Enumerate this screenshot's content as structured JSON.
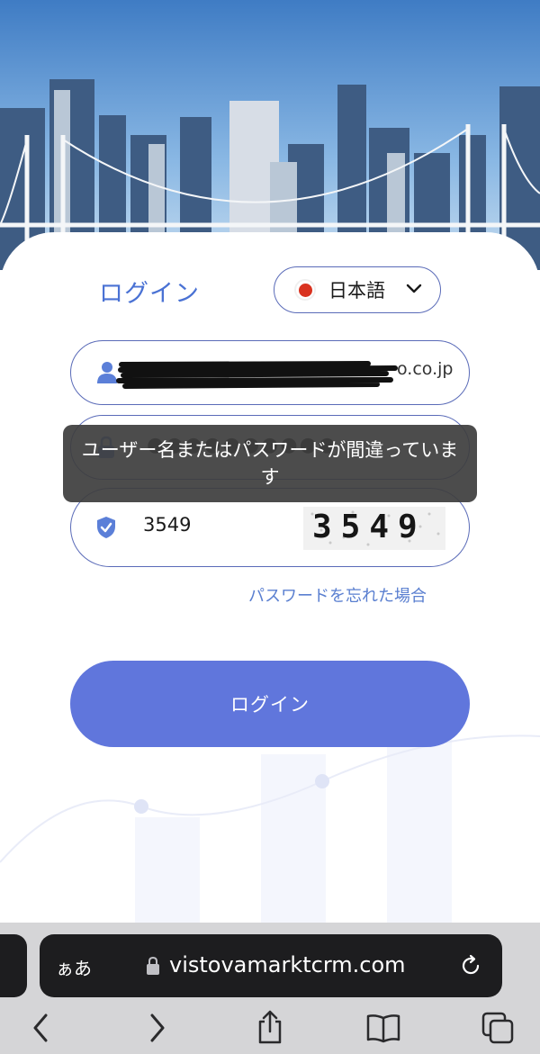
{
  "login": {
    "title": "ログイン",
    "language": "日本語",
    "username_tail": "o.co.jp",
    "password_mask": "●●●●●●●●●●",
    "captcha_value": "3549",
    "captcha_image_text": "3549",
    "forgot_password": "パスワードを忘れた場合",
    "submit_label": "ログイン"
  },
  "toast": {
    "message": "ユーザー名またはパスワードが間違っています"
  },
  "browser": {
    "text_size_label": "ぁあ",
    "domain": "vistovamarktcrm.com"
  },
  "colors": {
    "accent": "#4a72d4",
    "button": "#6076dc",
    "border": "#5a6bb8",
    "link": "#5a7fd0"
  },
  "icons": [
    "user-icon",
    "lock-icon",
    "shield-check-icon",
    "chevron-down-icon",
    "reload-icon",
    "back-icon",
    "forward-icon",
    "share-icon",
    "bookmarks-icon",
    "tabs-icon"
  ]
}
